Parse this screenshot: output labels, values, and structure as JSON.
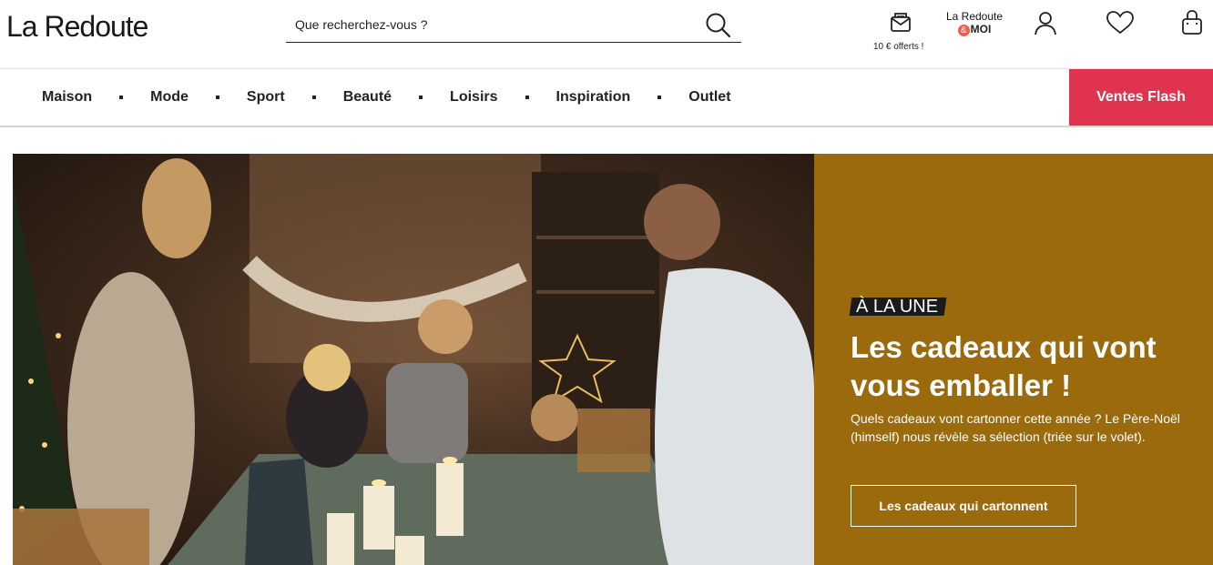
{
  "brand": {
    "logo": "La Redoute"
  },
  "search": {
    "placeholder": "Que recherchez-vous ?"
  },
  "header": {
    "offer_caption": "10 € offerts !",
    "loyalty_line1": "La Redoute",
    "loyalty_amp": "&",
    "loyalty_line2": "MOI"
  },
  "nav": {
    "items": [
      "Maison",
      "Mode",
      "Sport",
      "Beauté",
      "Loisirs",
      "Inspiration",
      "Outlet"
    ],
    "flash": "Ventes Flash"
  },
  "hero": {
    "kicker": "À LA UNE",
    "title": "Les cadeaux qui vont vous emballer !",
    "description": "Quels cadeaux vont cartonner cette année ? Le Père-Noël (himself) nous révèle sa sélection (triée sur le volet).",
    "cta": "Les cadeaux qui cartonnent"
  },
  "icons": {
    "search": "search-icon",
    "offer": "mail-gift-icon",
    "account": "user-icon",
    "wishlist": "heart-icon",
    "cart": "shopping-bag-icon"
  },
  "colors": {
    "flash_bg": "#e0334f",
    "hero_panel": "#9a6a0c",
    "accent_amp": "#e8604c"
  }
}
